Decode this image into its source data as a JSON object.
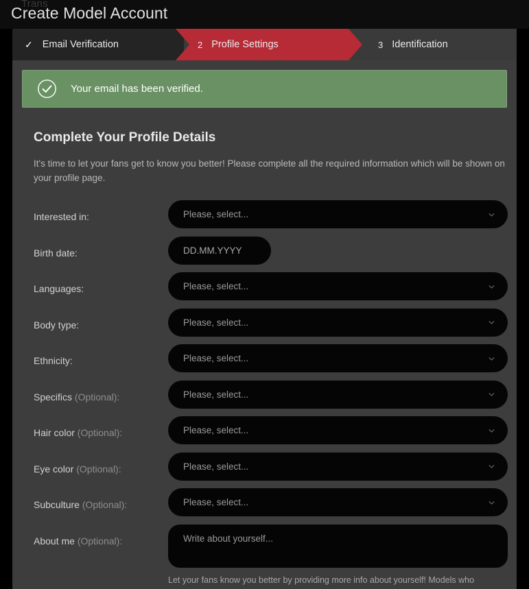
{
  "header": {
    "ghost_text": "Trans",
    "title": "Create Model Account"
  },
  "steps": [
    {
      "indicator": "✓",
      "label": "Email Verification",
      "state": "completed"
    },
    {
      "indicator": "2",
      "label": "Profile Settings",
      "state": "active"
    },
    {
      "indicator": "3",
      "label": "Identification",
      "state": "upcoming"
    }
  ],
  "alert": {
    "icon": "circle-check-icon",
    "message": "Your email has been verified.",
    "color": "#6a9164"
  },
  "section": {
    "title": "Complete Your Profile Details",
    "description": "It's time to let your fans get to know you better! Please complete all the required information which will be shown on your profile page."
  },
  "form": {
    "select_placeholder": "Please, select...",
    "fields": [
      {
        "label": "Interested in:",
        "optional": "",
        "type": "select",
        "value": "Please, select..."
      },
      {
        "label": "Birth date:",
        "optional": "",
        "type": "date",
        "value": "DD.MM.YYYY"
      },
      {
        "label": "Languages:",
        "optional": "",
        "type": "select",
        "value": "Please, select..."
      },
      {
        "label": "Body type:",
        "optional": "",
        "type": "select",
        "value": "Please, select..."
      },
      {
        "label": "Ethnicity:",
        "optional": "",
        "type": "select",
        "value": "Please, select..."
      },
      {
        "label": "Specifics ",
        "optional": "(Optional):",
        "type": "select",
        "value": "Please, select..."
      },
      {
        "label": "Hair color ",
        "optional": "(Optional):",
        "type": "select",
        "value": "Please, select..."
      },
      {
        "label": "Eye color ",
        "optional": "(Optional):",
        "type": "select",
        "value": "Please, select..."
      },
      {
        "label": "Subculture ",
        "optional": "(Optional):",
        "type": "select",
        "value": "Please, select..."
      },
      {
        "label": "About me ",
        "optional": "(Optional):",
        "type": "textarea",
        "value": "Write about yourself..."
      }
    ],
    "about_hint": "Let your fans know you better by providing more info about yourself! Models who"
  },
  "colors": {
    "accent": "#b62b36",
    "success": "#6a9164",
    "panel": "#3d3d3d",
    "field": "#050505"
  }
}
